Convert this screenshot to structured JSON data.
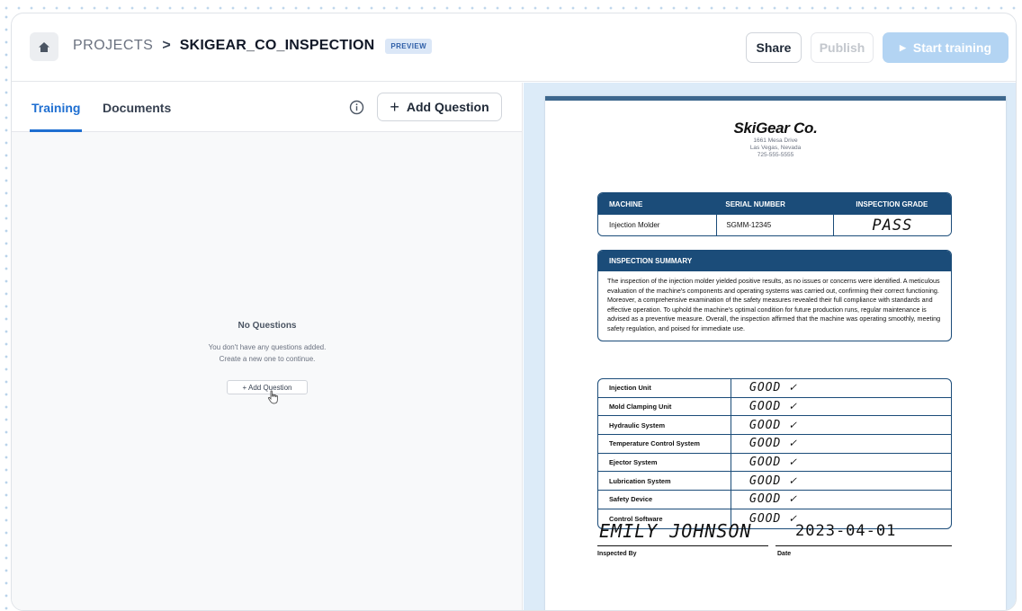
{
  "header": {
    "breadcrumb_root": "PROJECTS",
    "breadcrumb_sep": ">",
    "breadcrumb_current": "SKIGEAR_CO_INSPECTION",
    "badge": "PREVIEW",
    "share_label": "Share",
    "publish_label": "Publish",
    "start_label": "Start training"
  },
  "tabs": [
    {
      "label": "Training",
      "active": true
    },
    {
      "label": "Documents",
      "active": false
    }
  ],
  "add_question_label": "Add Question",
  "empty_state": {
    "title": "No Questions",
    "line1": "You don't have any questions added.",
    "line2": "Create a new one to continue.",
    "button_label": "+ Add Question"
  },
  "document": {
    "company": "SkiGear Co.",
    "address1": "1661 Mesa Drive",
    "address2": "Las Vegas, Nevada",
    "phone": "725-555-5555",
    "machine_table": {
      "headers": [
        "MACHINE",
        "SERIAL NUMBER",
        "INSPECTION GRADE"
      ],
      "row": [
        "Injection Molder",
        "SGMM-12345",
        "PASS"
      ]
    },
    "summary_title": "INSPECTION SUMMARY",
    "summary_text": "The inspection of the injection molder yielded positive results, as no issues or concerns were identified. A meticulous evaluation of the machine's components and operating systems was carried out, confirming their correct functioning. Moreover, a comprehensive examination of the safety measures revealed their full compliance with standards and effective operation. To uphold the machine's optimal condition for future production runs, regular maintenance is advised as a preventive measure. Overall, the inspection affirmed that the machine was operating smoothly, meeting safety regulation, and poised for immediate use.",
    "components": [
      {
        "name": "Injection Unit",
        "status": "GOOD ✓"
      },
      {
        "name": "Mold Clamping Unit",
        "status": "GOOD ✓"
      },
      {
        "name": "Hydraulic System",
        "status": "GOOD ✓"
      },
      {
        "name": "Temperature Control System",
        "status": "GOOD ✓"
      },
      {
        "name": "Ejector System",
        "status": "GOOD ✓"
      },
      {
        "name": "Lubrication System",
        "status": "GOOD ✓"
      },
      {
        "name": "Safety Device",
        "status": "GOOD ✓"
      },
      {
        "name": "Control Software",
        "status": "GOOD ✓"
      }
    ],
    "inspector_name": "EMILY JOHNSON",
    "inspection_date": "2023-04-01",
    "inspected_by_label": "Inspected By",
    "date_label": "Date"
  },
  "colors": {
    "accent": "#1f6fd1",
    "doc_navy": "#1b4c79",
    "preview_bg": "#dcebf8",
    "start_button": "#b3d4f3"
  }
}
